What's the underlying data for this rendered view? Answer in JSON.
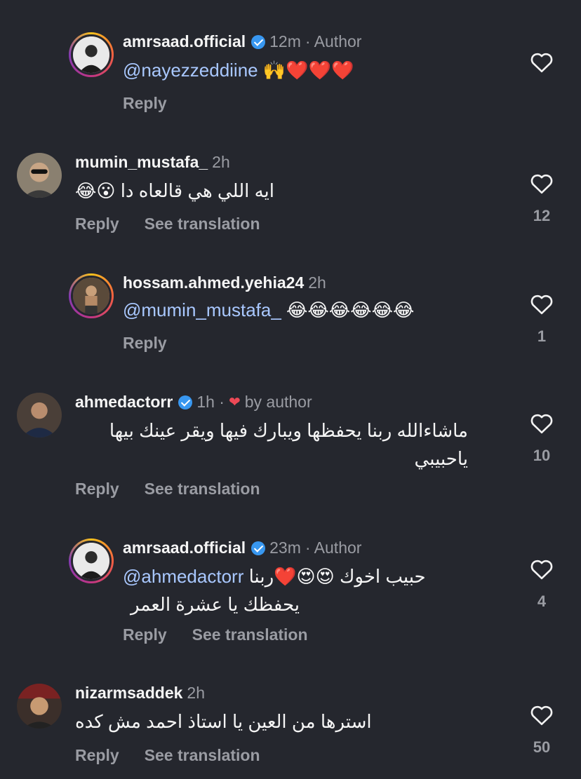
{
  "comments": [
    {
      "username": "amrsaad.official",
      "verified": true,
      "time": "12m",
      "tag": "· Author",
      "mention": "@nayezzeddiine",
      "text": "🙌❤️❤️❤️",
      "reply": "Reply",
      "likes": ""
    },
    {
      "username": "mumin_mustafa_",
      "verified": false,
      "time": "2h",
      "text": "ايه اللي هي قالعاه دا 😮😂",
      "reply": "Reply",
      "translate": "See translation",
      "likes": "12"
    },
    {
      "username": "hossam.ahmed.yehia24",
      "verified": false,
      "time": "2h",
      "mention": "@mumin_mustafa_",
      "text": "😂😂😂😂😂😂",
      "reply": "Reply",
      "likes": "1"
    },
    {
      "username": "ahmedactorr",
      "verified": true,
      "time": "1h ·",
      "byauthor": "by author",
      "text_line1": "ماشاءالله ربنا يحفظها ويبارك فيها ويقر عينك بيها",
      "text_line2": "ياحبيبي",
      "reply": "Reply",
      "translate": "See translation",
      "likes": "10"
    },
    {
      "username": "amrsaad.official",
      "verified": true,
      "time": "23m",
      "tag": "· Author",
      "mention": "@ahmedactorr",
      "text_line1": "حبيب اخوك 😍😍❤️ربنا",
      "text_line2": "يحفظك يا عشرة العمر",
      "reply": "Reply",
      "translate": "See translation",
      "likes": "4"
    },
    {
      "username": "nizarmsaddek",
      "verified": false,
      "time": "2h",
      "text": "استرها من العين يا استاذ احمد مش كده",
      "reply": "Reply",
      "translate": "See translation",
      "likes": "50"
    }
  ]
}
